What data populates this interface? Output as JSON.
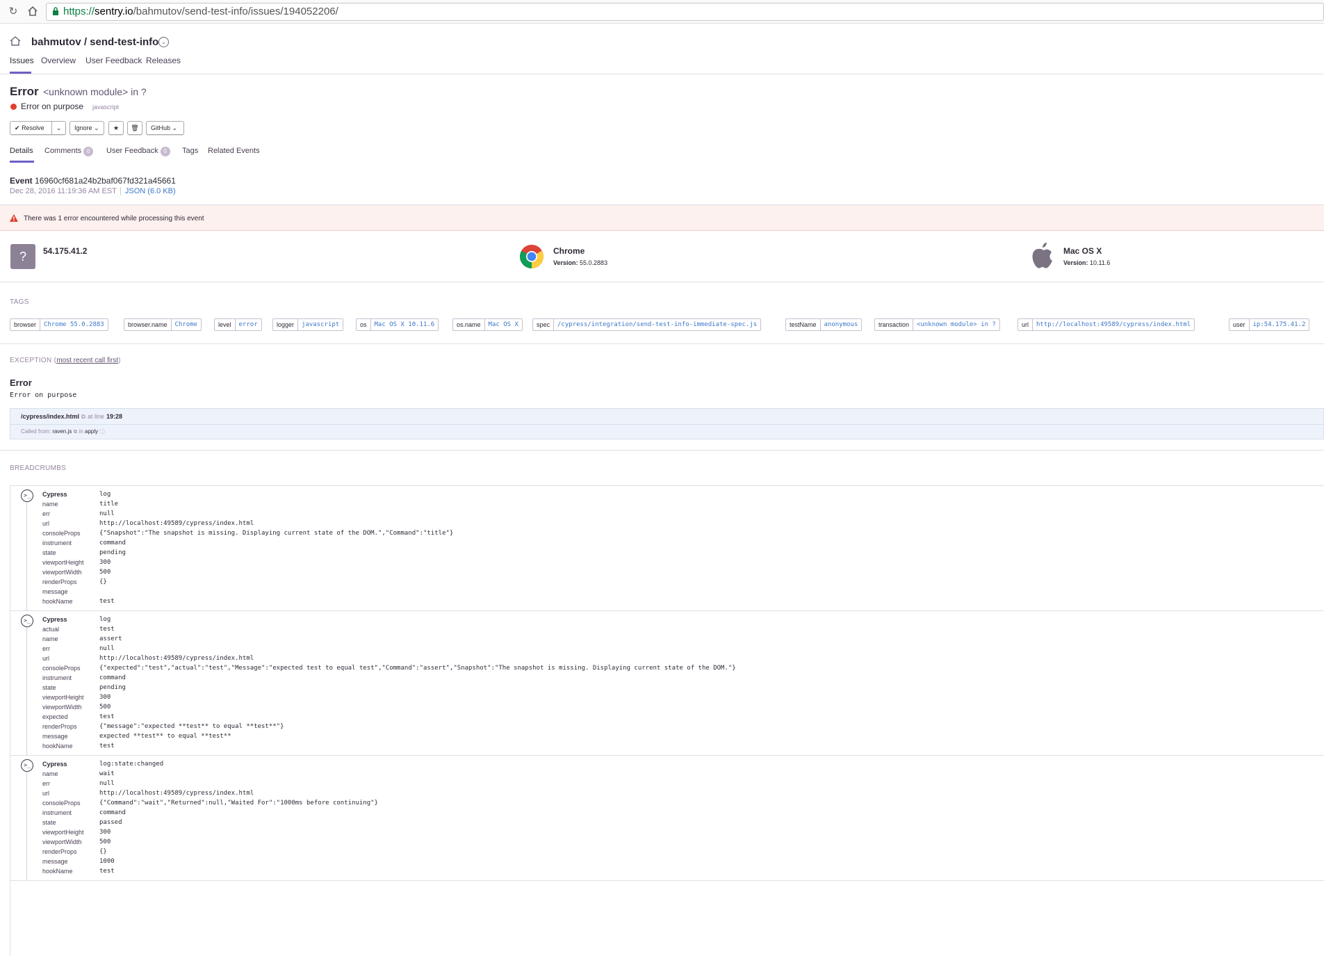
{
  "browser": {
    "url_scheme": "https://",
    "url_host": "sentry.io",
    "url_path": "/bahmutov/send-test-info/issues/194052206/"
  },
  "project": {
    "name": "bahmutov / send-test-info",
    "tabs": [
      "Issues",
      "Overview",
      "User Feedback",
      "Releases"
    ]
  },
  "issue": {
    "type": "Error",
    "culprit": "<unknown module> in ?",
    "message": "Error on purpose",
    "platform": "javascript"
  },
  "actions": {
    "resolve": "Resolve",
    "ignore": "Ignore",
    "github": "GitHub"
  },
  "sub_tabs": {
    "details": "Details",
    "comments": "Comments",
    "comments_count": "0",
    "user_feedback": "User Feedback",
    "user_feedback_count": "0",
    "tags": "Tags",
    "related": "Related Events"
  },
  "event": {
    "label": "Event",
    "id": "16960cf681a24b2baf067fd321a45661",
    "date": "Dec 28, 2016 11:19:36 AM EST",
    "json": "JSON (6.0 KB)"
  },
  "error_banner": "There was 1 error encountered while processing this event",
  "contexts": {
    "user": {
      "title": "54.175.41.2",
      "icon": "?"
    },
    "browser": {
      "title": "Chrome",
      "version_label": "Version:",
      "version": "55.0.2883"
    },
    "os": {
      "title": "Mac OS X",
      "version_label": "Version:",
      "version": "10.11.6"
    }
  },
  "tags_label": "TAGS",
  "tags": [
    {
      "key": "browser",
      "value": "Chrome 55.0.2883"
    },
    {
      "key": "browser.name",
      "value": "Chrome"
    },
    {
      "key": "level",
      "value": "error"
    },
    {
      "key": "logger",
      "value": "javascript"
    },
    {
      "key": "os",
      "value": "Mac OS X 10.11.6"
    },
    {
      "key": "os.name",
      "value": "Mac OS X"
    },
    {
      "key": "spec",
      "value": "/cypress/integration/send-test-info-immediate-spec.js"
    },
    {
      "key": "testName",
      "value": "anonymous"
    },
    {
      "key": "transaction",
      "value": "<unknown module> in ?"
    },
    {
      "key": "url",
      "value": "http://localhost:49589/cypress/index.html"
    },
    {
      "key": "user",
      "value": "ip:54.175.41.2"
    }
  ],
  "exception": {
    "label": "EXCEPTION",
    "label_note": "most recent call first",
    "type": "Error",
    "value": "Error on purpose",
    "frame_file": "/cypress/index.html",
    "frame_at": "at line",
    "frame_line": "19:28",
    "called_from_label": "Called from:",
    "called_from": "raven.js",
    "in_label": "in",
    "in_fn": "apply"
  },
  "breadcrumbs_label": "BREADCRUMBS",
  "breadcrumbs": [
    {
      "rows": [
        {
          "k": "Cypress",
          "v": "log"
        },
        {
          "k": "name",
          "v": "title"
        },
        {
          "k": "err",
          "v": "null"
        },
        {
          "k": "url",
          "v": "http://localhost:49589/cypress/index.html"
        },
        {
          "k": "consoleProps",
          "v": "{\"Snapshot\":\"The snapshot is missing. Displaying current state of the DOM.\",\"Command\":\"title\"}"
        },
        {
          "k": "instrument",
          "v": "command"
        },
        {
          "k": "state",
          "v": "pending"
        },
        {
          "k": "viewportHeight",
          "v": "300"
        },
        {
          "k": "viewportWidth",
          "v": "500"
        },
        {
          "k": "renderProps",
          "v": "{}"
        },
        {
          "k": "message",
          "v": ""
        },
        {
          "k": "hookName",
          "v": "test"
        }
      ]
    },
    {
      "rows": [
        {
          "k": "Cypress",
          "v": "log"
        },
        {
          "k": "actual",
          "v": "test"
        },
        {
          "k": "name",
          "v": "assert"
        },
        {
          "k": "err",
          "v": "null"
        },
        {
          "k": "url",
          "v": "http://localhost:49589/cypress/index.html"
        },
        {
          "k": "consoleProps",
          "v": "{\"expected\":\"test\",\"actual\":\"test\",\"Message\":\"expected test to equal test\",\"Command\":\"assert\",\"Snapshot\":\"The snapshot is missing. Displaying current state of the DOM.\"}"
        },
        {
          "k": "instrument",
          "v": "command"
        },
        {
          "k": "state",
          "v": "pending"
        },
        {
          "k": "viewportHeight",
          "v": "300"
        },
        {
          "k": "viewportWidth",
          "v": "500"
        },
        {
          "k": "expected",
          "v": "test"
        },
        {
          "k": "renderProps",
          "v": "{\"message\":\"expected **test** to equal **test**\"}"
        },
        {
          "k": "message",
          "v": "expected **test** to equal **test**"
        },
        {
          "k": "hookName",
          "v": "test"
        }
      ]
    },
    {
      "rows": [
        {
          "k": "Cypress",
          "v": "log:state:changed"
        },
        {
          "k": "name",
          "v": "wait"
        },
        {
          "k": "err",
          "v": "null"
        },
        {
          "k": "url",
          "v": "http://localhost:49589/cypress/index.html"
        },
        {
          "k": "consoleProps",
          "v": "{\"Command\":\"wait\",\"Returned\":null,\"Waited For\":\"1000ms before continuing\"}"
        },
        {
          "k": "instrument",
          "v": "command"
        },
        {
          "k": "state",
          "v": "passed"
        },
        {
          "k": "viewportHeight",
          "v": "300"
        },
        {
          "k": "viewportWidth",
          "v": "500"
        },
        {
          "k": "renderProps",
          "v": "{}"
        },
        {
          "k": "message",
          "v": "1000"
        },
        {
          "k": "hookName",
          "v": "test"
        }
      ]
    }
  ]
}
